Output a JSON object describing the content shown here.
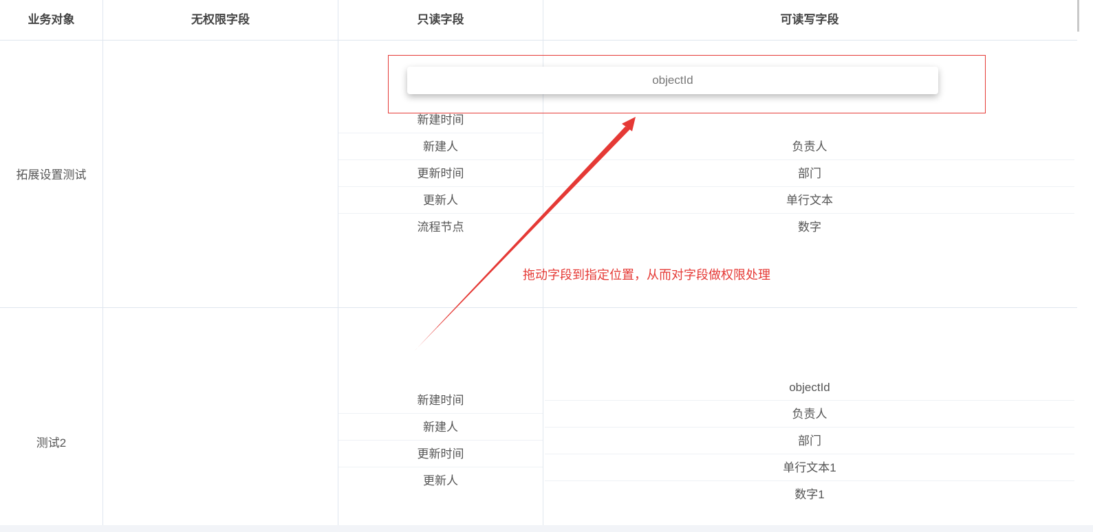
{
  "table": {
    "headers": {
      "business_object": "业务对象",
      "no_permission": "无权限字段",
      "read_only": "只读字段",
      "read_write": "可读写字段"
    },
    "rows": [
      {
        "object": "拓展设置测试",
        "read_only": [
          "新建时间",
          "新建人",
          "更新时间",
          "更新人",
          "流程节点"
        ],
        "read_write": [
          "负责人",
          "部门",
          "单行文本",
          "数字"
        ]
      },
      {
        "object": "测试2",
        "read_only": [
          "新建时间",
          "新建人",
          "更新时间",
          "更新人"
        ],
        "read_write": [
          "objectId",
          "负责人",
          "部门",
          "单行文本1",
          "数字1"
        ]
      }
    ]
  },
  "dragging_field": "objectId",
  "annotation": {
    "text": "拖动字段到指定位置，从而对字段做权限处理",
    "color": "#e53935"
  }
}
